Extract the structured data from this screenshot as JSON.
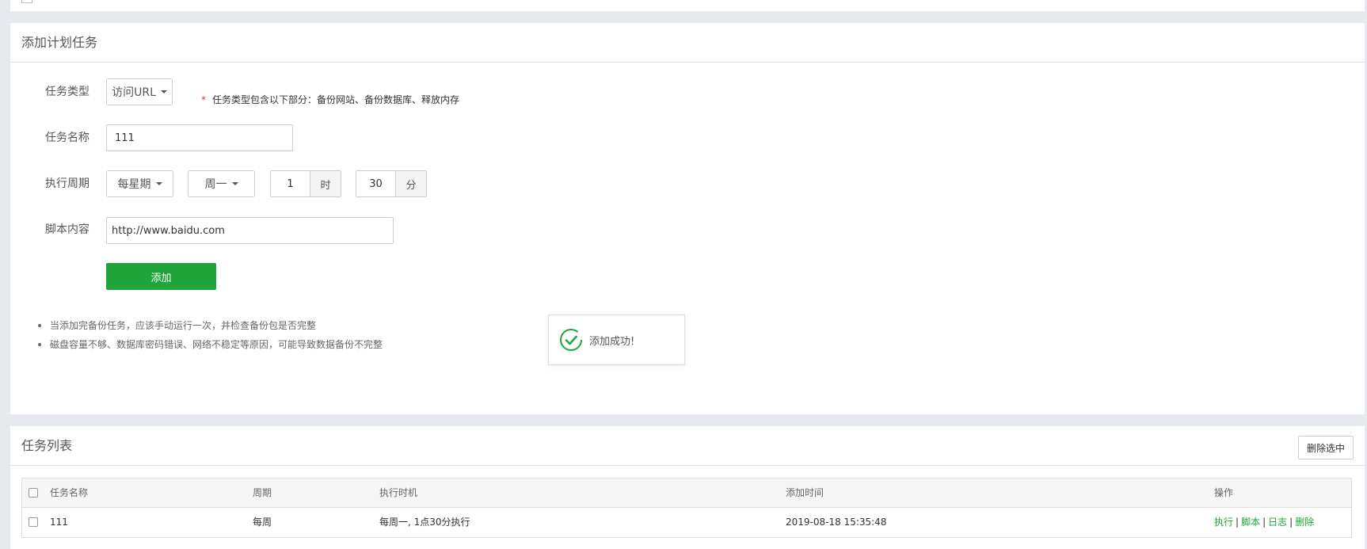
{
  "add_panel": {
    "title": "添加计划任务",
    "task_type": {
      "label": "任务类型",
      "value": "访问URL",
      "hint_star": "*",
      "hint": "任务类型包含以下部分：备份网站、备份数据库、释放内存"
    },
    "task_name": {
      "label": "任务名称",
      "value": "111"
    },
    "cycle": {
      "label": "执行周期",
      "period_value": "每星期",
      "weekday_value": "周一",
      "hour_value": "1",
      "hour_unit": "时",
      "minute_value": "30",
      "minute_unit": "分"
    },
    "script": {
      "label": "脚本内容",
      "value": "http://www.baidu.com"
    },
    "add_button": "添加",
    "notes": [
      "当添加完备份任务，应该手动运行一次，并检查备份包是否完整",
      "磁盘容量不够、数据库密码错误、网络不稳定等原因，可能导致数据备份不完整"
    ]
  },
  "toast": {
    "message": "添加成功!"
  },
  "list_panel": {
    "title": "任务列表",
    "delete_selected": "删除选中",
    "columns": [
      "任务名称",
      "周期",
      "执行时机",
      "添加时间",
      "操作"
    ],
    "rows": [
      {
        "name": "111",
        "cycle": "每周",
        "timing": "每周一, 1点30分执行",
        "added": "2019-08-18 15:35:48",
        "actions": [
          "执行",
          "脚本",
          "日志",
          "删除"
        ],
        "separator": "|"
      }
    ]
  },
  "colors": {
    "accent": "#20a53a",
    "required_star": "#e4393c",
    "background": "#e6e9ee"
  }
}
